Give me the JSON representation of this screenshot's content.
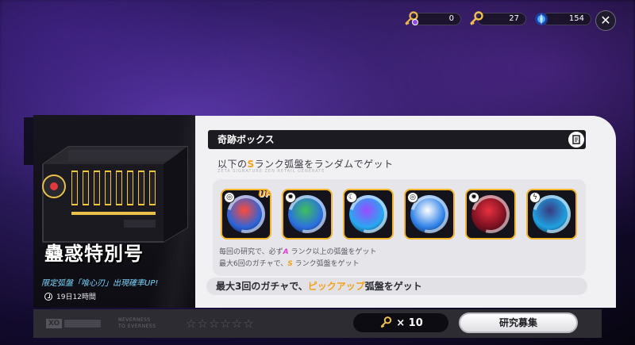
{
  "currencies": [
    {
      "icon": "key-with-purple-gem-icon",
      "value": "0"
    },
    {
      "icon": "golden-key-icon",
      "value": "27"
    },
    {
      "icon": "blue-crystal-icon",
      "value": "154"
    }
  ],
  "close_label": "✕",
  "left_panel": {
    "title": "蠱惑特別号",
    "subtitle": "限定弧盤「喰心刃」出現確率UP!",
    "time_left": "19日12時間"
  },
  "card": {
    "header": "奇跡ボックス",
    "desc_prefix": "以下の",
    "desc_rank": "S",
    "desc_suffix": "ランク弧盤をランダムでゲット",
    "small_text": "ZETA SIGNATURE ZEN RETAIL GENERATE",
    "disks": [
      {
        "category": "swirl",
        "up": "UP",
        "colors": [
          "#ff4a3a",
          "#2c64d8"
        ]
      },
      {
        "category": "gear",
        "up": "",
        "colors": [
          "#3fbf5c",
          "#2a6fe0"
        ]
      },
      {
        "category": "moon",
        "up": "",
        "colors": [
          "#9a4bff",
          "#27a8f0"
        ]
      },
      {
        "category": "swirl",
        "up": "",
        "colors": [
          "#ffffff",
          "#2d80e8"
        ]
      },
      {
        "category": "gear",
        "up": "",
        "colors": [
          "#e83040",
          "#7a1020"
        ]
      },
      {
        "category": "bolt",
        "up": "",
        "colors": [
          "#3a3a80",
          "#1fa0e0"
        ]
      }
    ],
    "note1_prefix": "毎回の研究で、必ず",
    "note1_rank": "A",
    "note1_suffix": " ランク以上の弧盤をゲット",
    "note2_prefix": "最大6回のガチャで、",
    "note2_rank": "S",
    "note2_suffix": " ランク弧盤をゲット",
    "bottom_prefix": "最大3回のガチャで、",
    "bottom_highlight": "ピックアップ",
    "bottom_suffix": "弧盤をゲット"
  },
  "footer": {
    "logo": "XO",
    "tagline_1": "NEVERNESS",
    "tagline_2": "TO EVERNESS",
    "stars": "☆☆☆☆☆☆",
    "cost": "× 10",
    "recruit_label": "研究募集"
  }
}
